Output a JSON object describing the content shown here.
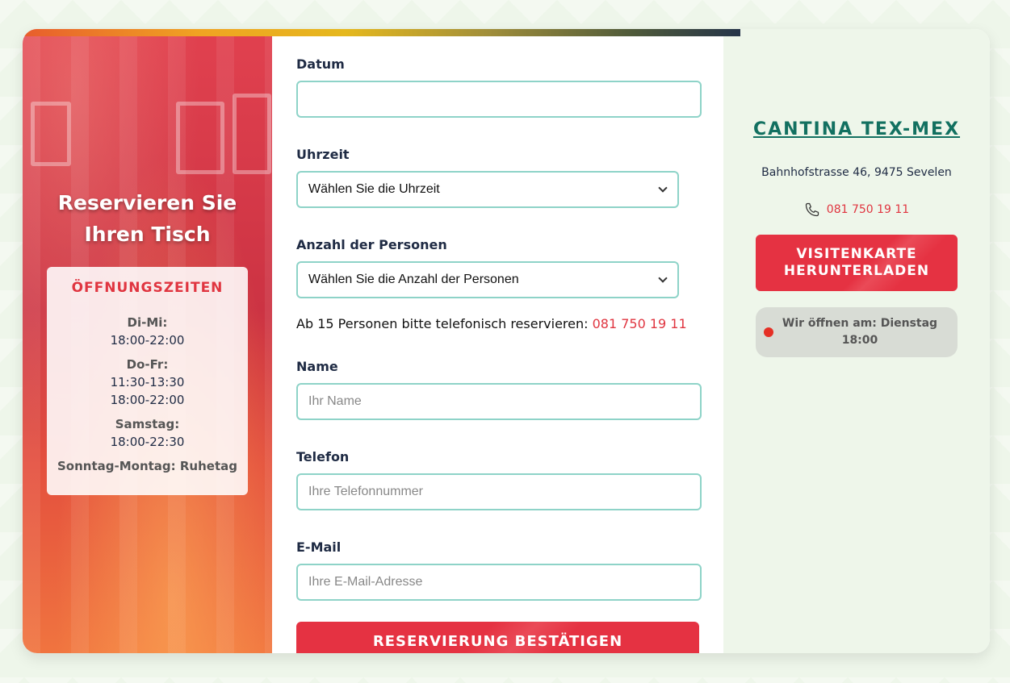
{
  "hero": {
    "title_line1": "Reservieren Sie",
    "title_line2": "Ihren Tisch"
  },
  "hours": {
    "heading": "ÖFFNUNGSZEITEN",
    "groups": [
      {
        "day": "Di-Mi:",
        "times": [
          "18:00-22:00"
        ]
      },
      {
        "day": "Do-Fr:",
        "times": [
          "11:30-13:30",
          "18:00-22:00"
        ]
      },
      {
        "day": "Samstag:",
        "times": [
          "18:00-22:30"
        ]
      },
      {
        "day": "Sonntag-Montag: Ruhetag",
        "times": []
      }
    ]
  },
  "form": {
    "date": {
      "label": "Datum",
      "value": ""
    },
    "time": {
      "label": "Uhrzeit",
      "selected": "Wählen Sie die Uhrzeit"
    },
    "persons": {
      "label": "Anzahl der Personen",
      "selected": "Wählen Sie die Anzahl der Personen"
    },
    "note": "Ab 15 Personen bitte telefonisch reservieren:",
    "note_phone": "081 750 19 11",
    "name": {
      "label": "Name",
      "placeholder": "Ihr Name"
    },
    "phone": {
      "label": "Telefon",
      "placeholder": "Ihre Telefonnummer"
    },
    "email": {
      "label": "E-Mail",
      "placeholder": "Ihre E-Mail-Adresse"
    },
    "submit_label": "RESERVIERUNG BESTÄTIGEN"
  },
  "info": {
    "brand": "CANTINA TEX-MEX",
    "address": "Bahnhofstrasse 46, 9475 Sevelen",
    "phone": "081 750 19 11",
    "phone_icon": "phone-icon",
    "vcard_line1": "VISITENKARTE",
    "vcard_line2": "HERUNTERLADEN",
    "status_line1": "Wir öffnen am: Dienstag",
    "status_line2": "18:00",
    "status_color": "#e53025"
  },
  "colors": {
    "accent_red": "#e53242",
    "brand_green": "#127060",
    "field_border": "#8ed3c8"
  }
}
